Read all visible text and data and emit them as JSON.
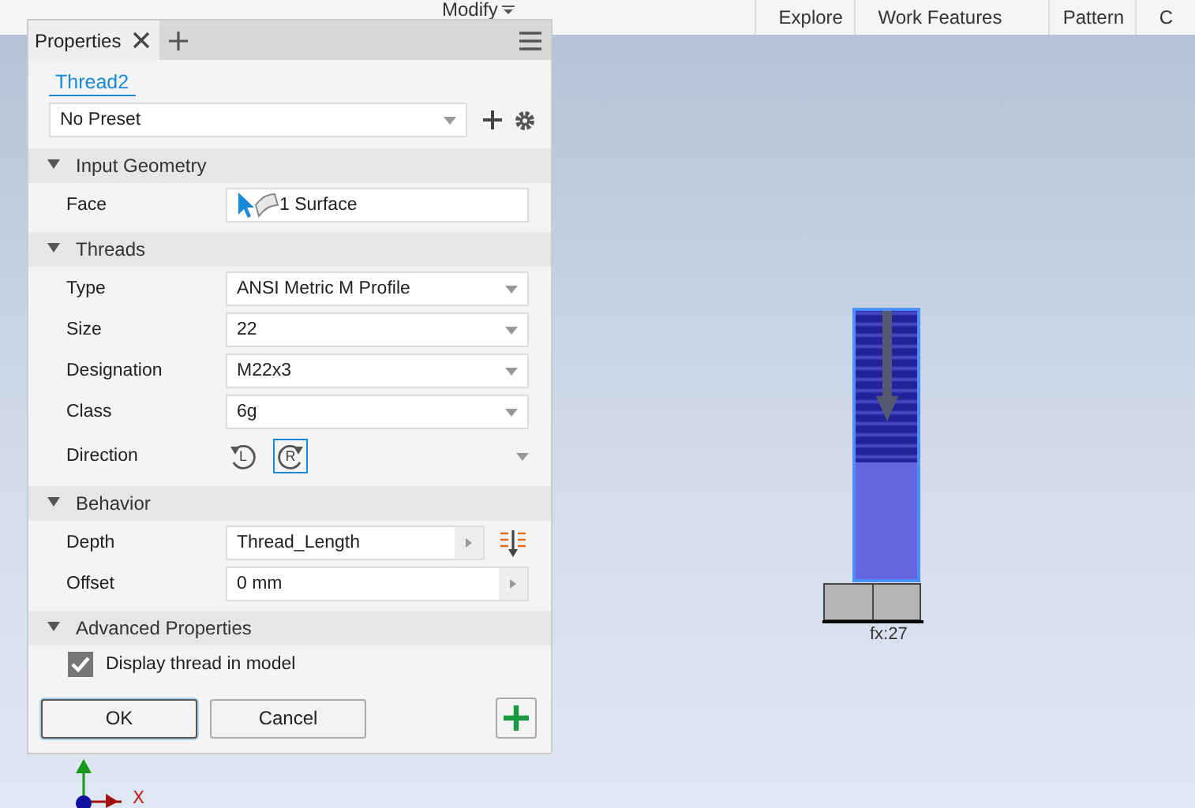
{
  "ribbon": {
    "groups": [
      {
        "label": "Modify",
        "dropdown": true
      },
      {
        "label": "Explore",
        "dropdown": false
      },
      {
        "label": "Work Features",
        "dropdown": false
      },
      {
        "label": "Pattern",
        "dropdown": false
      },
      {
        "label": "C",
        "dropdown": false
      }
    ]
  },
  "panel": {
    "tabs": [
      {
        "label": "Properties",
        "selected": true
      }
    ],
    "feature_name": "Thread2",
    "preset": {
      "value": "No Preset"
    },
    "sections": [
      {
        "title": "Input Geometry",
        "expanded": true,
        "rows": [
          {
            "kind": "selection",
            "label": "Face",
            "value": "1 Surface"
          }
        ]
      },
      {
        "title": "Threads",
        "expanded": true,
        "rows": [
          {
            "kind": "dropdown",
            "label": "Type",
            "value": "ANSI Metric M Profile"
          },
          {
            "kind": "dropdown",
            "label": "Size",
            "value": "22"
          },
          {
            "kind": "dropdown",
            "label": "Designation",
            "value": "M22x3"
          },
          {
            "kind": "dropdown",
            "label": "Class",
            "value": "6g"
          },
          {
            "kind": "direction",
            "label": "Direction",
            "options": [
              {
                "letter": "L",
                "selected": false
              },
              {
                "letter": "R",
                "selected": true
              }
            ]
          }
        ]
      },
      {
        "title": "Behavior",
        "expanded": true,
        "rows": [
          {
            "kind": "expression",
            "label": "Depth",
            "value": "Thread_Length",
            "extra_icon": true
          },
          {
            "kind": "expression",
            "label": "Offset",
            "value": "0 mm",
            "extra_icon": false
          }
        ]
      },
      {
        "title": "Advanced Properties",
        "expanded": true,
        "rows": [
          {
            "kind": "checkbox",
            "label": "Display thread in model",
            "checked": true
          }
        ]
      }
    ],
    "buttons": [
      {
        "label": "OK",
        "default": true
      },
      {
        "label": "Cancel",
        "default": false
      }
    ]
  },
  "model": {
    "dimension": "fx:27"
  },
  "axes": {
    "x_label": "X"
  }
}
